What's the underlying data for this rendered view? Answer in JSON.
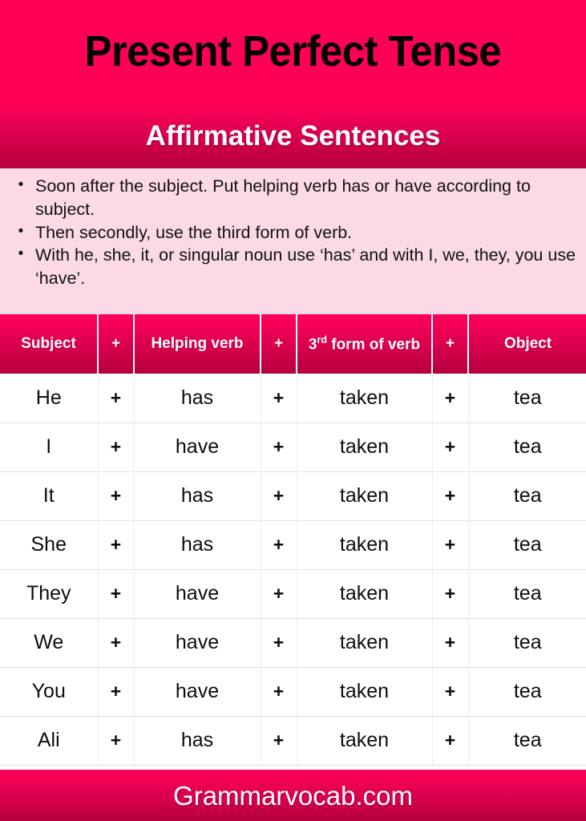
{
  "header": {
    "title": "Present Perfect Tense",
    "subtitle": "Affirmative Sentences"
  },
  "rules": {
    "bullet_glyph": "•",
    "items": [
      "Soon after the subject. Put helping verb has or have according to subject.",
      "Then secondly, use the third form of verb.",
      "With he, she, it, or singular noun use ‘has’ and with I, we, they, you use ‘have’."
    ]
  },
  "table": {
    "columns": [
      {
        "label": "Subject",
        "sup": ""
      },
      {
        "label": "+",
        "sup": ""
      },
      {
        "label": "Helping verb",
        "sup": ""
      },
      {
        "label": "+",
        "sup": ""
      },
      {
        "label": " form of verb",
        "sup_prefix": "3",
        "sup": "rd"
      },
      {
        "label": "+",
        "sup": ""
      },
      {
        "label": "Object",
        "sup": ""
      }
    ],
    "header": {
      "subject": "Subject",
      "plus1": "+",
      "helping_verb": "Helping verb",
      "plus2": "+",
      "third_form_prefix": "3",
      "third_form_sup": "rd",
      "third_form_rest": " form of verb",
      "plus3": "+",
      "object": "Object"
    },
    "rows": [
      {
        "subject": "He",
        "plus1": "+",
        "helping": "has",
        "plus2": "+",
        "form": "taken",
        "plus3": "+",
        "object": "tea"
      },
      {
        "subject": "I",
        "plus1": "+",
        "helping": "have",
        "plus2": "+",
        "form": "taken",
        "plus3": "+",
        "object": "tea"
      },
      {
        "subject": "It",
        "plus1": "+",
        "helping": "has",
        "plus2": "+",
        "form": "taken",
        "plus3": "+",
        "object": "tea"
      },
      {
        "subject": "She",
        "plus1": "+",
        "helping": "has",
        "plus2": "+",
        "form": "taken",
        "plus3": "+",
        "object": "tea"
      },
      {
        "subject": "They",
        "plus1": "+",
        "helping": "have",
        "plus2": "+",
        "form": "taken",
        "plus3": "+",
        "object": "tea"
      },
      {
        "subject": "We",
        "plus1": "+",
        "helping": "have",
        "plus2": "+",
        "form": "taken",
        "plus3": "+",
        "object": "tea"
      },
      {
        "subject": "You",
        "plus1": "+",
        "helping": "have",
        "plus2": "+",
        "form": "taken",
        "plus3": "+",
        "object": "tea"
      },
      {
        "subject": "Ali",
        "plus1": "+",
        "helping": "has",
        "plus2": "+",
        "form": "taken",
        "plus3": "+",
        "object": "tea"
      }
    ]
  },
  "footer": {
    "site": "Grammarvocab.com"
  },
  "colors": {
    "accent_bright": "#ff0059",
    "accent_dark": "#b4003f",
    "rules_background": "#fbd9e6",
    "title_text": "#000000",
    "body_text": "#0d0d0d"
  }
}
